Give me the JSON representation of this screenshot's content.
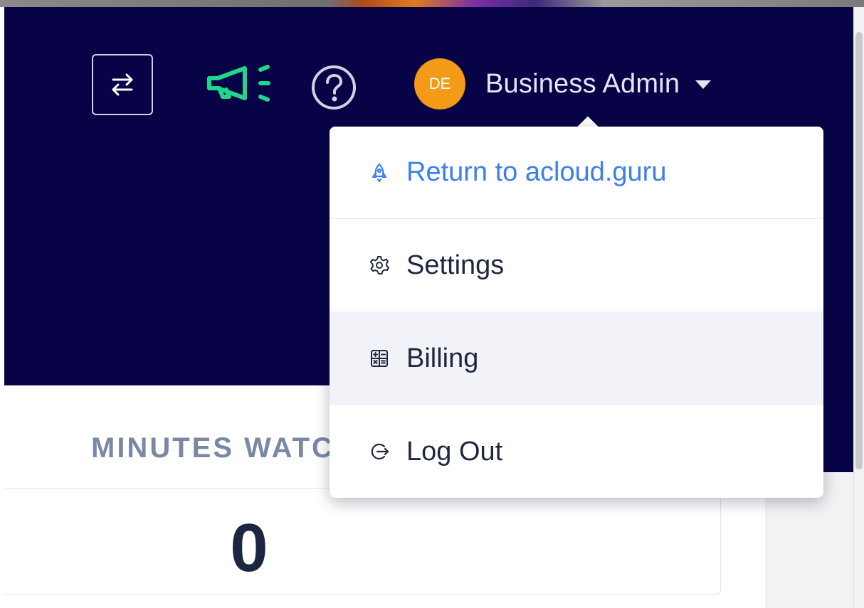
{
  "header": {
    "switch_icon": "switch-arrows-icon",
    "announcements_icon": "megaphone-icon",
    "help_icon": "help-circle-icon",
    "colors": {
      "background": "#070346",
      "announcement_green": "#1fd68b",
      "avatar_orange": "#f39a16"
    }
  },
  "user": {
    "initials": "DE",
    "name": "Business Admin",
    "caret_icon": "caret-down-icon"
  },
  "dropdown": {
    "items": [
      {
        "label": "Return to acloud.guru",
        "icon": "rocket-icon",
        "color": "#3c7ef0"
      },
      {
        "label": "Settings",
        "icon": "gear-icon"
      },
      {
        "label": "Billing",
        "icon": "calculator-icon",
        "highlighted": true
      },
      {
        "label": "Log Out",
        "icon": "logout-icon"
      }
    ]
  },
  "stats": {
    "label": "MINUTES WATC",
    "value": "0"
  }
}
